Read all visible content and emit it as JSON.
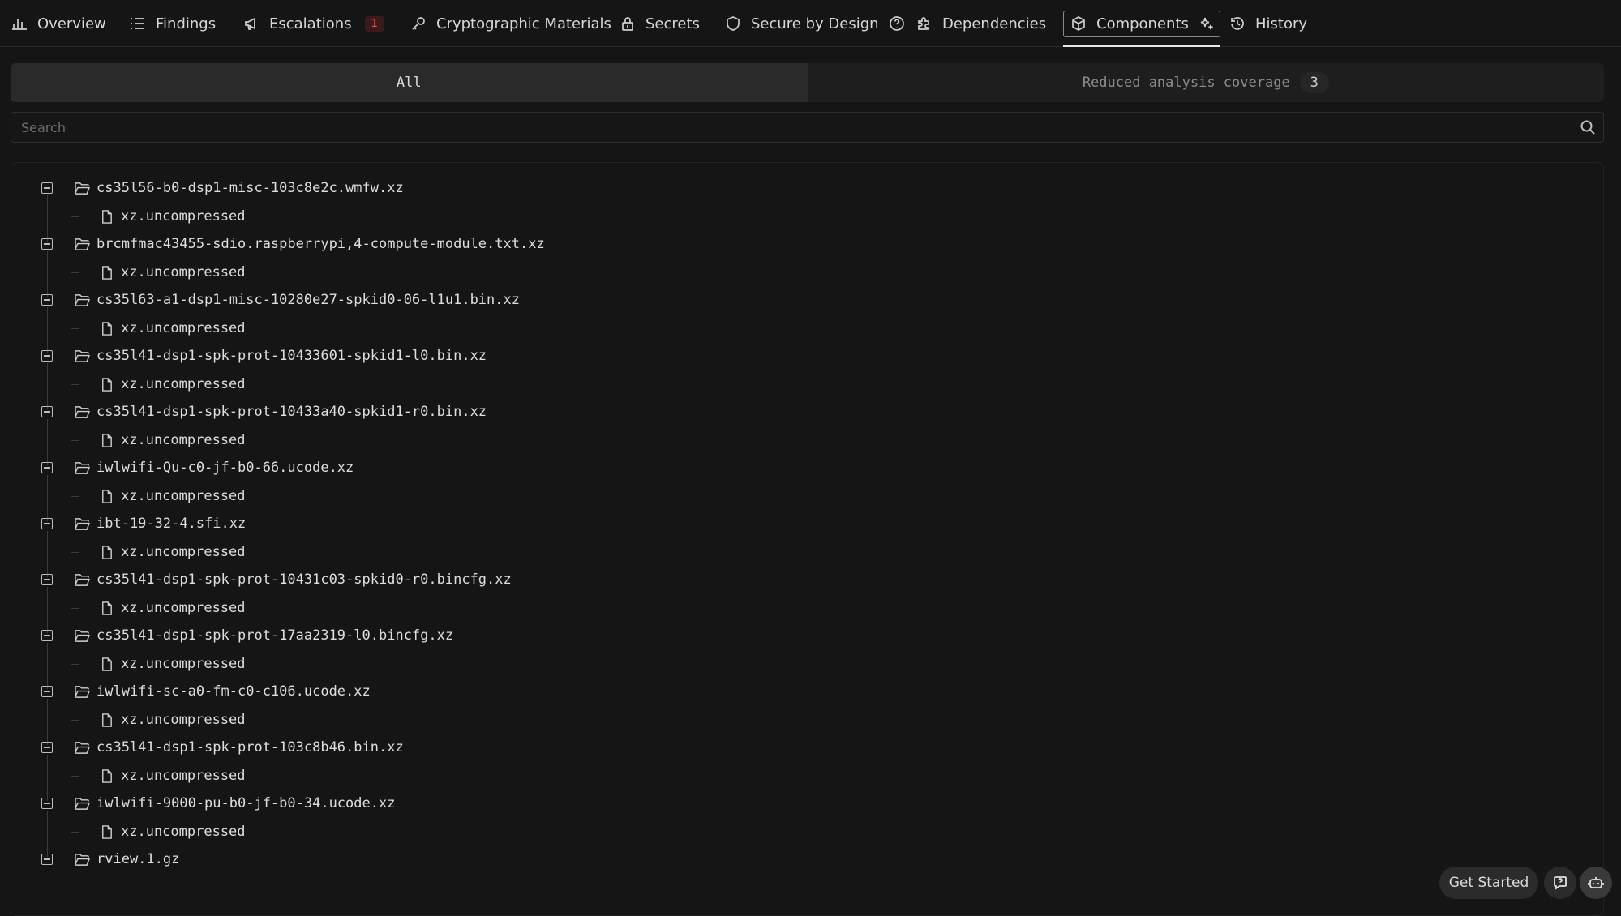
{
  "nav": {
    "tabs": [
      {
        "label": "Overview",
        "icon": "bar-chart-icon"
      },
      {
        "label": "Findings",
        "icon": "list-icon"
      },
      {
        "label": "Escalations",
        "icon": "megaphone-icon",
        "badge": "1"
      },
      {
        "label": "Cryptographic Materials",
        "icon": "key-icon"
      },
      {
        "label": "Secrets",
        "icon": "lock-icon"
      },
      {
        "label": "Secure by Design",
        "icon": "shield-icon"
      },
      {
        "label": "Dependencies",
        "icon": "puzzle-icon"
      },
      {
        "label": "Components",
        "icon": "cube-icon",
        "active": true
      },
      {
        "label": "History",
        "icon": "history-icon"
      }
    ]
  },
  "filter": {
    "all_label": "All",
    "reduced_label": "Reduced analysis coverage",
    "reduced_count": "3"
  },
  "search": {
    "placeholder": "Search"
  },
  "tree": {
    "items": [
      {
        "name": "cs35l56-b0-dsp1-misc-103c8e2c.wmfw.xz",
        "child": "xz.uncompressed"
      },
      {
        "name": "brcmfmac43455-sdio.raspberrypi,4-compute-module.txt.xz",
        "child": "xz.uncompressed"
      },
      {
        "name": "cs35l63-a1-dsp1-misc-10280e27-spkid0-06-l1u1.bin.xz",
        "child": "xz.uncompressed"
      },
      {
        "name": "cs35l41-dsp1-spk-prot-10433601-spkid1-l0.bin.xz",
        "child": "xz.uncompressed"
      },
      {
        "name": "cs35l41-dsp1-spk-prot-10433a40-spkid1-r0.bin.xz",
        "child": "xz.uncompressed"
      },
      {
        "name": "iwlwifi-Qu-c0-jf-b0-66.ucode.xz",
        "child": "xz.uncompressed"
      },
      {
        "name": "ibt-19-32-4.sfi.xz",
        "child": "xz.uncompressed"
      },
      {
        "name": "cs35l41-dsp1-spk-prot-10431c03-spkid0-r0.bincfg.xz",
        "child": "xz.uncompressed"
      },
      {
        "name": "cs35l41-dsp1-spk-prot-17aa2319-l0.bincfg.xz",
        "child": "xz.uncompressed"
      },
      {
        "name": "iwlwifi-sc-a0-fm-c0-c106.ucode.xz",
        "child": "xz.uncompressed"
      },
      {
        "name": "cs35l41-dsp1-spk-prot-103c8b46.bin.xz",
        "child": "xz.uncompressed"
      },
      {
        "name": "iwlwifi-9000-pu-b0-jf-b0-34.ucode.xz",
        "child": "xz.uncompressed"
      },
      {
        "name": "rview.1.gz"
      }
    ]
  },
  "footer": {
    "get_started_label": "Get Started",
    "help_icon": "question-bubble-icon",
    "bot_icon": "robot-icon"
  }
}
